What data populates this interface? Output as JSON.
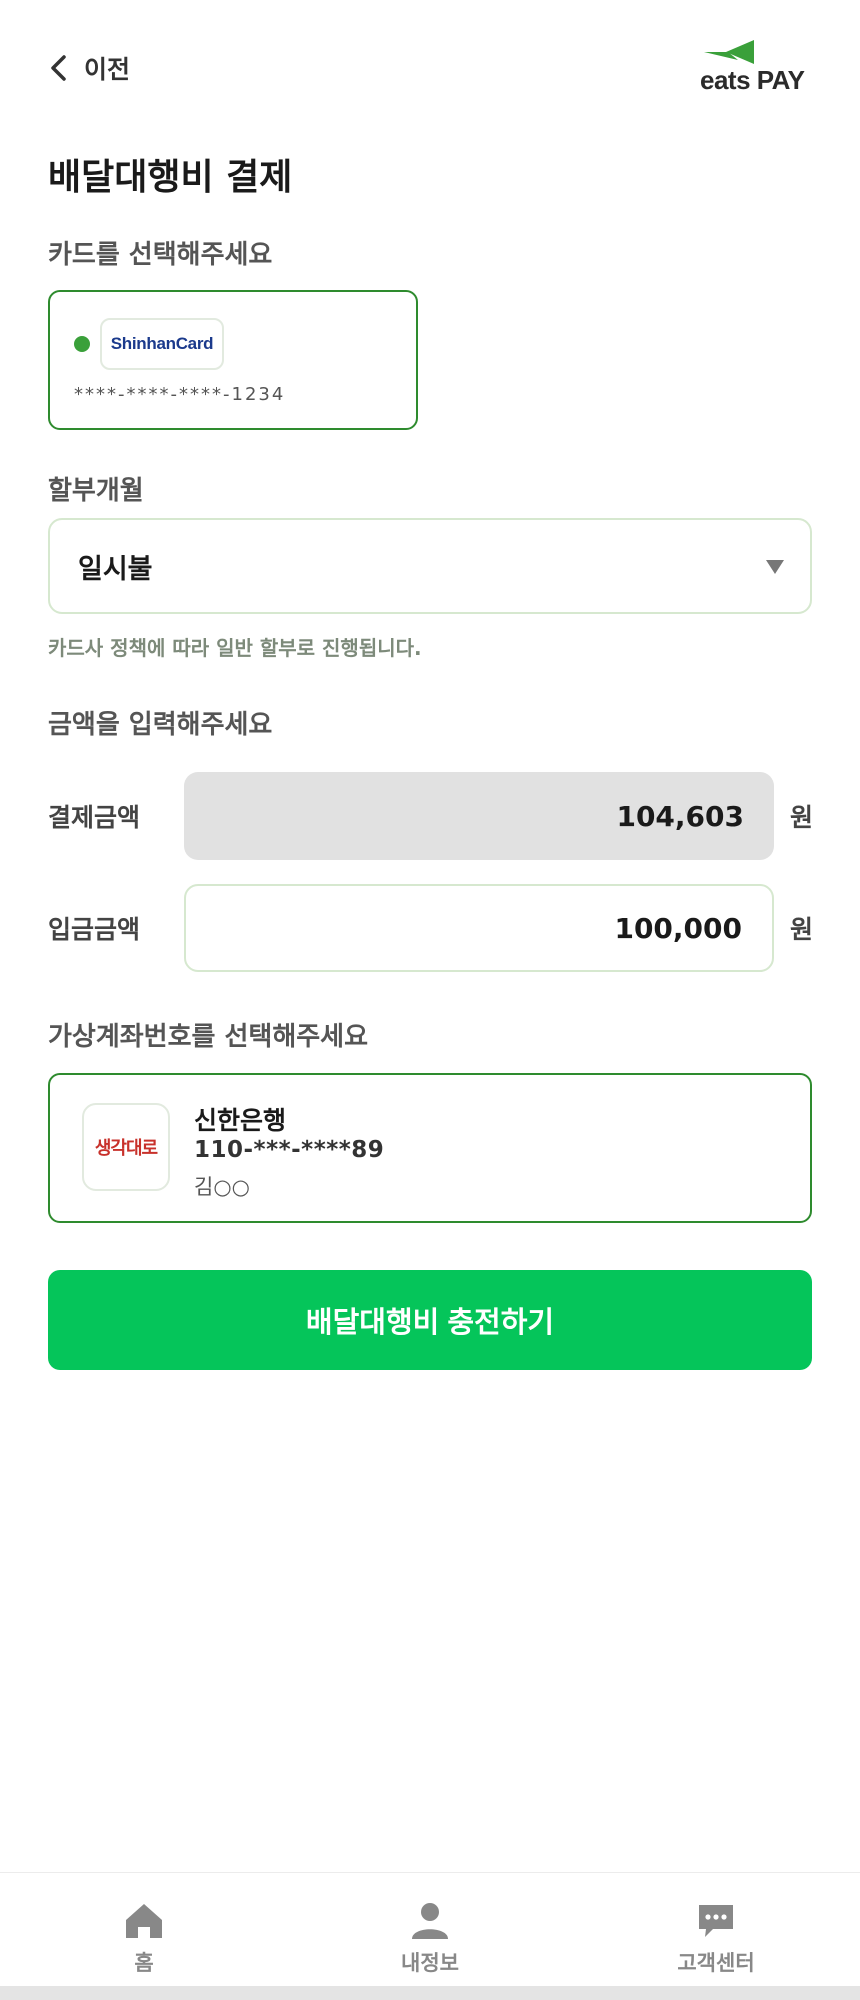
{
  "header": {
    "back_label": "이전",
    "logo_text": "eats PAY"
  },
  "page_title": "배달대행비 결제",
  "card_section": {
    "label": "카드를 선택해주세요",
    "card": {
      "brand": "ShinhanCard",
      "number": "****-****-****-1234"
    }
  },
  "installment": {
    "label": "할부개월",
    "selected": "일시불",
    "helper": "카드사 정책에 따라 일반 할부로 진행됩니다."
  },
  "amount_section": {
    "label": "금액을 입력해주세요",
    "payment": {
      "label": "결제금액",
      "value": "104,603",
      "unit": "원"
    },
    "deposit": {
      "label": "입금금액",
      "value": "100,000",
      "unit": "원"
    }
  },
  "account_section": {
    "label": "가상계좌번호를 선택해주세요",
    "account": {
      "logo_text": "생각대로",
      "bank": "신한은행",
      "number": "110-***-****89",
      "holder": "김○○"
    }
  },
  "primary_button": "배달대행비 충전하기",
  "bottom_nav": {
    "items": [
      {
        "label": "홈",
        "icon": "home-icon"
      },
      {
        "label": "내정보",
        "icon": "person-icon"
      },
      {
        "label": "고객센터",
        "icon": "chat-icon"
      }
    ]
  },
  "colors": {
    "accent": "#05c55a",
    "border_selected": "#2e8b2e",
    "logo_green": "#3aa03a"
  }
}
